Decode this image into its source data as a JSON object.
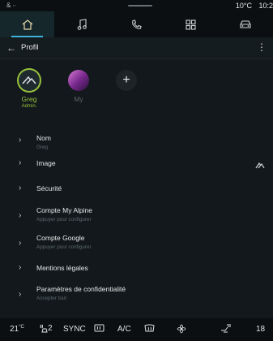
{
  "status": {
    "left_icons": "& ∙∙",
    "temperature": "10°C",
    "time": "10:2"
  },
  "nav": {
    "tabs": [
      {
        "icon": "home-icon",
        "active": true
      },
      {
        "icon": "music-icon",
        "active": false
      },
      {
        "icon": "phone-icon",
        "active": false
      },
      {
        "icon": "apps-icon",
        "active": false
      },
      {
        "icon": "car-icon",
        "active": false
      }
    ],
    "accent": "#3fb0d9"
  },
  "header": {
    "back_glyph": "←",
    "title": "Profil",
    "more_glyph": "⋮"
  },
  "profiles": {
    "greg": {
      "name": "Greg",
      "role": "Admin."
    },
    "my": {
      "name": "My"
    },
    "add_glyph": "+"
  },
  "list": [
    {
      "label": "Nom",
      "sub": "Greg"
    },
    {
      "label": "Image"
    },
    {
      "label": "Sécurité"
    },
    {
      "label": "Compte My Alpine",
      "sub": "Appuyer pour configurer"
    },
    {
      "label": "Compte Google",
      "sub": "Appuyer pour configurer"
    },
    {
      "label": "Mentions légales"
    },
    {
      "label": "Paramètres de confidentialité",
      "sub": "Accepter tout"
    }
  ],
  "climate": {
    "temp_left": "21",
    "temp_left_unit": "°C",
    "seat_level": "2",
    "sync": "SYNC",
    "ac": "A/C",
    "temp_right": "18"
  },
  "colors": {
    "accent_green": "#98c13d",
    "background": "#12181b"
  }
}
